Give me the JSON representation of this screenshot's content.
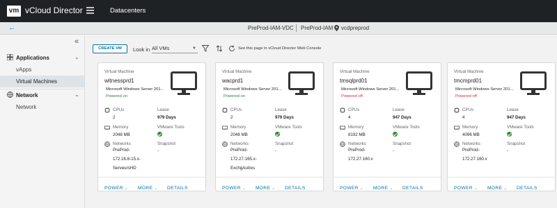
{
  "header": {
    "logo_text": "vm",
    "app_title": "vCloud Director",
    "nav_label": "Datacenters"
  },
  "context": {
    "vdc": "PreProd-IAM-VDC",
    "org": "PreProd-IAM",
    "site": "vcdpreprod"
  },
  "sidebar": {
    "sections": [
      {
        "label": "Applications",
        "items": [
          "vApps",
          "Virtual Machines"
        ],
        "active": "Virtual Machines"
      },
      {
        "label": "Network",
        "items": [
          "Network"
        ]
      }
    ]
  },
  "toolbar": {
    "create_vm": "CREATE VM",
    "look_in_label": "Look in",
    "look_in_value": "All VMs",
    "console_link": "See this page in vCloud Director Web Console"
  },
  "labels": {
    "type": "Virtual Machine",
    "cpus": "CPUs",
    "lease": "Lease",
    "memory": "Memory",
    "vmware_tools": "VMware Tools",
    "networks": "Networks",
    "snapshot": "Snapshot",
    "power": "POWER",
    "more": "MORE",
    "details": "DETAILS"
  },
  "vms": [
    {
      "name": "witnessprd1",
      "os": "Microsoft Windows Server 201...",
      "status": "Powered on",
      "cpus": "2",
      "lease": "979 Days",
      "memory": "2048 MB",
      "snapshot": "-",
      "network_lines": [
        "PreProd-",
        "172.16.8-15.x-",
        "ServeursHD"
      ]
    },
    {
      "name": "wacprd1",
      "os": "Microsoft Windows Server 201...",
      "status": "Powered on",
      "cpus": "2",
      "lease": "979 Days",
      "memory": "2048 MB",
      "snapshot": "-",
      "network_lines": [
        "PreProd-",
        "172.27.165.x-",
        "ExchgAutres"
      ]
    },
    {
      "name": "tmsqlprd01",
      "os": "Microsoft Windows Server 201...",
      "status": "Powered off",
      "cpus": "4",
      "lease": "947 Days",
      "memory": "8192 MB",
      "snapshot": "-",
      "network_lines": [
        "PreProd-",
        "172.27.160.x"
      ]
    },
    {
      "name": "tmcmprd01",
      "os": "Microsoft Windows Server 201...",
      "status": "Powered off",
      "cpus": "4",
      "lease": "947 Days",
      "memory": "4096 MB",
      "snapshot": "-",
      "network_lines": [
        "PreProd-",
        "172.27.160.x"
      ]
    }
  ],
  "colors": {
    "header_bg": "#1f2224",
    "accent": "#0072a3",
    "powered_on": "#2e7d32",
    "powered_off": "#d32f2f",
    "tools_ok": "#2e8b2e"
  }
}
